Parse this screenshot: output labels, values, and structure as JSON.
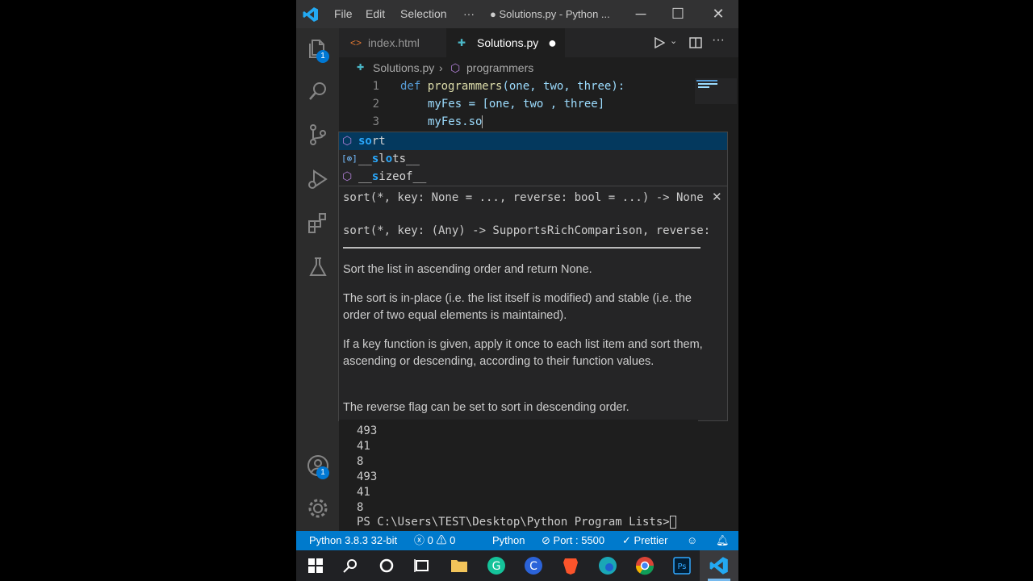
{
  "titlebar": {
    "menu": [
      "File",
      "Edit",
      "Selection",
      "···"
    ],
    "window_title": "● Solutions.py - Python ..."
  },
  "activity": {
    "explorer_badge": "1",
    "accounts_badge": "1"
  },
  "tabs": [
    {
      "label": "index.html"
    },
    {
      "label": "Solutions.py"
    }
  ],
  "breadcrumb": {
    "file": "Solutions.py",
    "symbol": "programmers"
  },
  "editor": {
    "line_numbers": [
      "1",
      "2",
      "3"
    ],
    "line1": {
      "kw": "def",
      "fn": "programmers",
      "rest": "(one, two, three):"
    },
    "line2": {
      "var": "myFes",
      "rest": " = [one, two , three]"
    },
    "line3": "myFes.so"
  },
  "suggest": {
    "items": [
      {
        "match": "so",
        "rest": "rt"
      },
      {
        "pre": "__",
        "match": "s",
        "mid": "l",
        "match2": "o",
        "rest": "ts__"
      },
      {
        "pre": "__",
        "match": "s",
        "mid": "izeof__"
      }
    ]
  },
  "hover": {
    "sig1": "sort(*, key: None = ..., reverse: bool = ...) -> None",
    "sig2": "sort(*, key: (Any) -> SupportsRichComparison, reverse:",
    "doc": [
      "Sort the list in ascending order and return None.",
      "The sort is in-place (i.e. the list itself is modified) and stable (i.e. the order of two equal elements is maintained).",
      "If a key function is given, apply it once to each list item and sort them, ascending or descending, according to their function values.",
      "The reverse flag can be set to sort in descending order."
    ]
  },
  "terminal": {
    "lines": [
      "493",
      "41",
      "8",
      "493",
      "41",
      "8"
    ],
    "prompt": "PS C:\\Users\\TEST\\Desktop\\Python Program Lists>"
  },
  "status": {
    "python": "Python 3.8.3 32-bit",
    "errors": "0",
    "warnings": "0",
    "language": "Python",
    "port": "Port : 5500",
    "prettier": "Prettier"
  },
  "colors": {
    "accent": "#007acc",
    "selection": "#04395e"
  }
}
